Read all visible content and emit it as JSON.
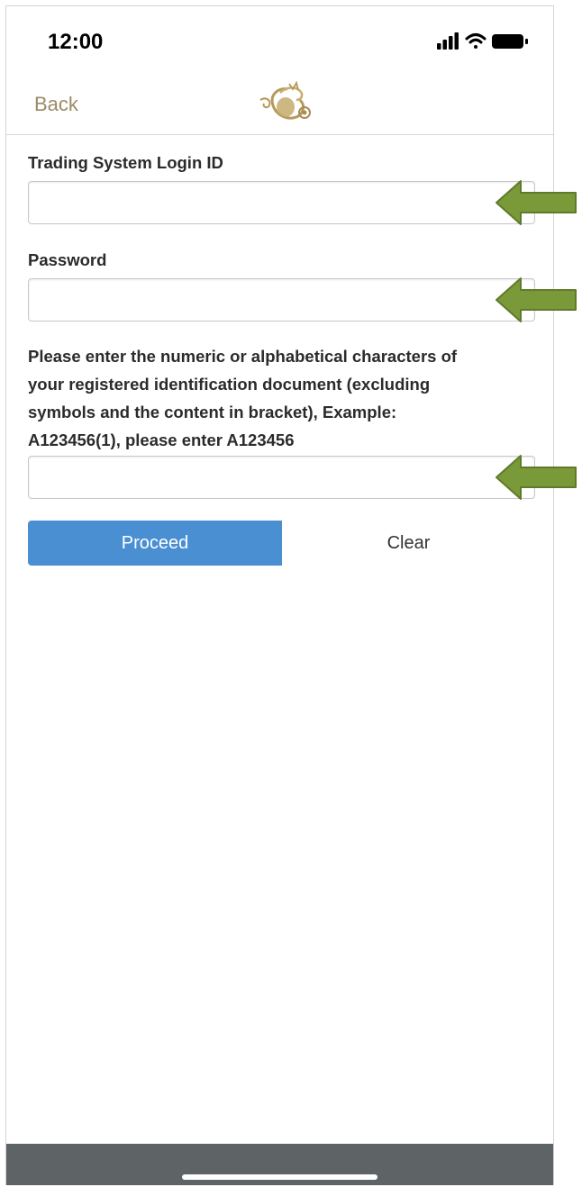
{
  "status_bar": {
    "time": "12:00",
    "icons": [
      "signal-icon",
      "wifi-icon",
      "battery-icon"
    ]
  },
  "nav": {
    "back_label": "Back",
    "logo_icon": "dragon-logo-icon"
  },
  "form": {
    "login_id": {
      "label": "Trading System Login ID",
      "value": "",
      "placeholder": ""
    },
    "password": {
      "label": "Password",
      "value": "",
      "placeholder": ""
    },
    "id_document": {
      "instruction_lines": [
        "Please enter the numeric or alphabetical characters of",
        "your registered identification document (excluding",
        "symbols and the content in bracket), Example:",
        "A123456(1), please enter A123456"
      ],
      "value": "",
      "placeholder": ""
    }
  },
  "buttons": {
    "proceed_label": "Proceed",
    "clear_label": "Clear"
  },
  "annotations": {
    "arrow_icon": "green-arrow-icon",
    "arrow_color": "#7a9a3a"
  },
  "colors": {
    "accent": "#4a8fd2",
    "back_link": "#9b8a67",
    "home_bar": "#5e6466"
  }
}
